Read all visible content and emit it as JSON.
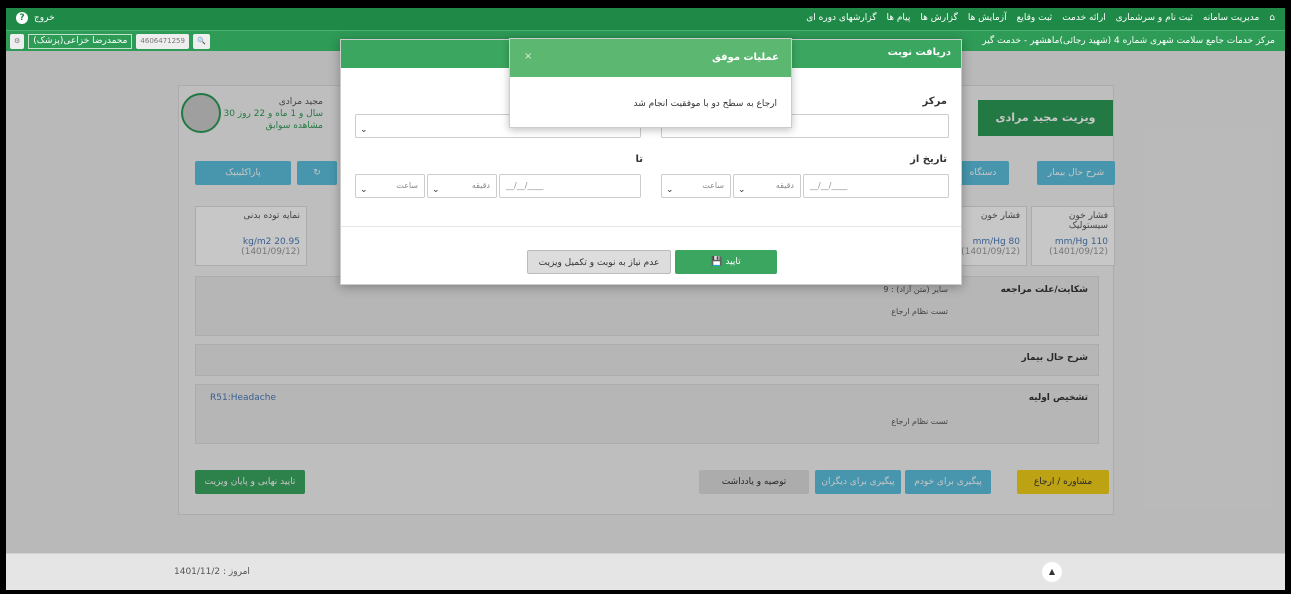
{
  "topnav": {
    "menu": [
      "مدیریت سامانه",
      "ثبت نام و سرشماری",
      "ارائه خدمت",
      "ثبت وقایع",
      "آزمایش ها",
      "گزارش ها",
      "پیام ها",
      "گزارشهای دوره ای"
    ],
    "exit_label": "خروج",
    "help_icon": "?"
  },
  "subnav": {
    "center_label": "مرکز خدمات جامع سلامت شهری شماره 4 (شهید رجائی)ماهشهر",
    "service_label": "خدمت گیر",
    "search_value": "4606471259",
    "user_label": "محمدرضا خزاعی(پزشک)"
  },
  "panel": {
    "visit_title": "ویزیت مجید مرادی",
    "patient_name": "مجید مرادی",
    "patient_age": "30 سال و 1 ماه و 22 روز",
    "record_link": "مشاهده سوابق",
    "paraclinic_btn": "پاراکلینیک",
    "history_btn": "شرح حال بیمار",
    "device_btn": "دستگاه",
    "vitals": [
      {
        "label": "فشار خون سیستولیک",
        "value": "mm/Hg 110",
        "date": "(1401/09/12)"
      },
      {
        "label": "فشار خون",
        "value": "mm/Hg 80",
        "date": "(1401/09/12)"
      },
      {
        "label": "نمایه توده بدنی",
        "value": "kg/m2 20.95",
        "date": "(1401/09/12)"
      }
    ],
    "complaint_head": "شکایت/علت مراجعه",
    "complaint_snippet": "9 : سایر (متن آزاد)",
    "complaint_text": "تست نظام ارجاع",
    "history_head": "شرح حال بیمار",
    "diagnosis_head": "تشخیص اولیه",
    "diagnosis_code": "R51:Headache",
    "diagnosis_text": "تست نظام ارجاع",
    "buttons": {
      "consult": "مشاوره / ارجاع",
      "followup_self": "پیگیری برای خودم",
      "followup_others": "پیگیری برای دیگران",
      "notes": "توصیه و یادداشت",
      "final_confirm": "تایید نهایی و پایان ویزیت"
    }
  },
  "dialog": {
    "title": "دریافت نوبت",
    "center_label": "مرکز",
    "from_label": "تاریخ از",
    "to_label": "تا",
    "date_placeholder": "__/__/____",
    "minute_label": "دقیقه",
    "hour_label": "ساعت",
    "confirm_btn": "تایید",
    "no_need_btn": "عدم نیاز به نوبت و تکمیل ویزیت"
  },
  "toast": {
    "title": "عملیات موفق",
    "message": "ارجاع به سطح دو با موفقیت انجام شد",
    "close": "×"
  },
  "footer": {
    "today_label": "امروز : 1401/11/2"
  },
  "colors": {
    "primary_green": "#1f8a47",
    "accent_blue": "#5bc0de",
    "warning_yellow": "#f3d11a"
  }
}
